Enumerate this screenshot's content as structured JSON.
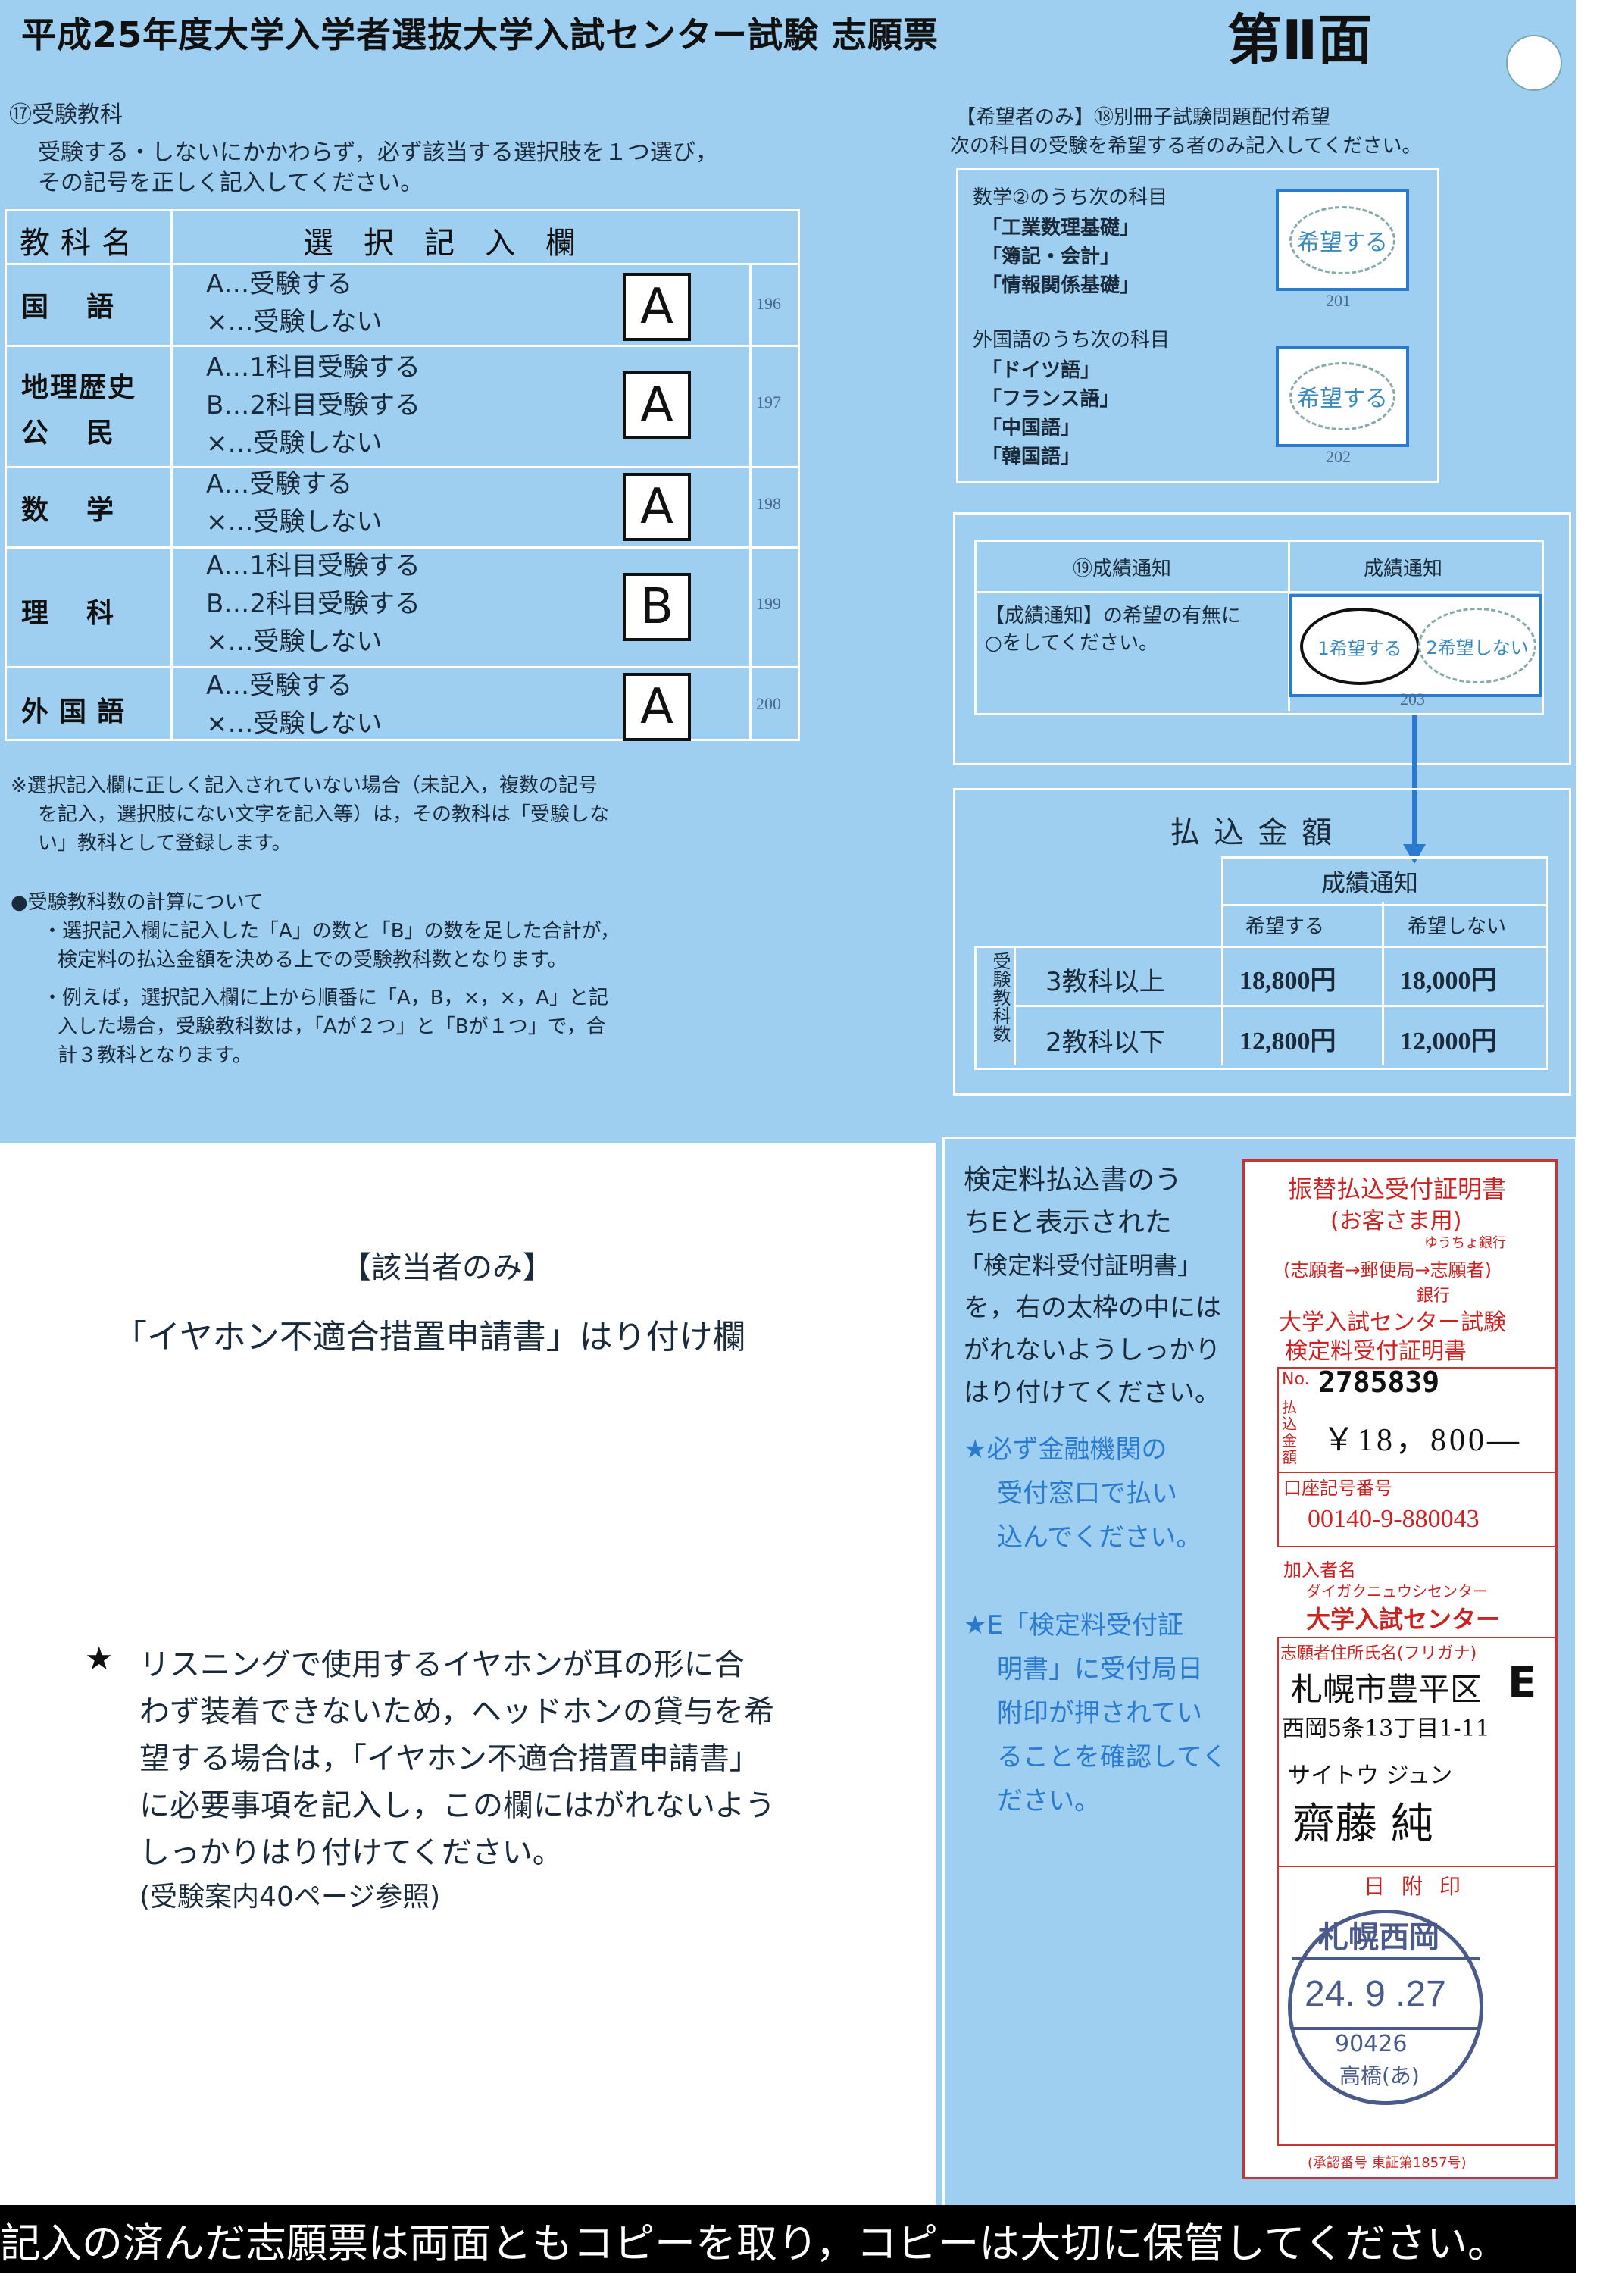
{
  "header": {
    "title": "平成25年度大学入学者選抜大学入試センター試験 志願票",
    "side": "第Ⅱ面"
  },
  "section17": {
    "heading": "⑰受験教科",
    "instr1": "受験する・しないにかかわらず，必ず該当する選択肢を１つ選び，",
    "instr2": "その記号を正しく記入してください。",
    "col_subject": "教科名",
    "col_select": "選択記入欄",
    "rows": [
      {
        "name": "国語",
        "options": [
          "A…受験する",
          "×…受験しない"
        ],
        "answer": "A",
        "code": "196"
      },
      {
        "name1": "地理歴史",
        "name2": "公民",
        "options": [
          "A…1科目受験する",
          "B…2科目受験する",
          "×…受験しない"
        ],
        "answer": "A",
        "code": "197"
      },
      {
        "name": "数学",
        "options": [
          "A…受験する",
          "×…受験しない"
        ],
        "answer": "A",
        "code": "198"
      },
      {
        "name": "理科",
        "options": [
          "A…1科目受験する",
          "B…2科目受験する",
          "×…受験しない"
        ],
        "answer": "B",
        "code": "199"
      },
      {
        "name": "外国語",
        "options": [
          "A…受験する",
          "×…受験しない"
        ],
        "answer": "A",
        "code": "200"
      }
    ],
    "note1": "※選択記入欄に正しく記入されていない場合（未記入，複数の記号",
    "note2": "を記入，選択肢にない文字を記入等）は，その教科は「受験しな",
    "note3": "い」教科として登録します。",
    "calc_heading": "●受験教科数の計算について",
    "calc1": "・選択記入欄に記入した「A」の数と「B」の数を足した合計が，",
    "calc2": "検定料の払込金額を決める上での受験教科数となります。",
    "calc3": "・例えば，選択記入欄に上から順番に「A，B，×，×，A」と記",
    "calc4": "入した場合，受験教科数は，「Aが２つ」と「Bが１つ」で，合",
    "calc5": "計３教科となります。"
  },
  "section18": {
    "heading": "【希望者のみ】⑱別冊子試験問題配付希望",
    "sub": "次の科目の受験を希望する者のみ記入してください。",
    "group1_title": "数学②のうち次の科目",
    "group1": [
      "「工業数理基礎」",
      "「簿記・会計」",
      "「情報関係基礎」"
    ],
    "group1_opt": "希望する",
    "group1_code": "201",
    "group2_title": "外国語のうち次の科目",
    "group2": [
      "「ドイツ語」",
      "「フランス語」",
      "「中国語」",
      "「韓国語」"
    ],
    "group2_opt": "希望する",
    "group2_code": "202"
  },
  "section19": {
    "heading": "⑲成績通知",
    "col": "成績通知",
    "desc1": "【成績通知】の希望の有無に",
    "desc2": "○をしてください。",
    "opt1": "1希望する",
    "opt2": "2希望しない",
    "code": "203"
  },
  "fees": {
    "title": "払込金額",
    "header": "成績通知",
    "col1": "希望する",
    "col2": "希望しない",
    "side": "受験教科数",
    "rows": [
      {
        "label": "3教科以上",
        "v1": "18,800円",
        "v2": "18,000円"
      },
      {
        "label": "2教科以下",
        "v1": "12,800円",
        "v2": "12,000円"
      }
    ]
  },
  "earphone": {
    "heading": "【該当者のみ】",
    "title": "「イヤホン不適合措置申請書」はり付け欄",
    "star": "★",
    "body1": "リスニングで使用するイヤホンが耳の形に合",
    "body2": "わず装着できないため，ヘッドホンの貸与を希",
    "body3": "望する場合は，「イヤホン不適合措置申請書」",
    "body4": "に必要事項を記入し，この欄にはがれないよう",
    "body5": "しっかりはり付けてください。",
    "ref": "(受験案内40ページ参照)"
  },
  "receipt_instr": {
    "l1": "検定料払込書のう",
    "l2": "ちEと表示された",
    "l3": "「検定料受付証明書」",
    "l4": "を，右の太枠の中には",
    "l5": "がれないようしっかり",
    "l6": "はり付けてください。",
    "s1a": "★必ず金融機関の",
    "s1b": "受付窓口で払い",
    "s1c": "込んでください。",
    "s2a": "★E「検定料受付証",
    "s2b": "明書」に受付局日",
    "s2c": "附印が押されてい",
    "s2d": "ることを確認してく",
    "s2e": "ださい。"
  },
  "certificate": {
    "t1": "振替払込受付証明書",
    "t2": "(お客さま用)",
    "t3": "ゆうちょ銀行",
    "t4": "(志願者→郵便局→志願者)",
    "t5": "銀行",
    "t6": "大学入試センター試験",
    "t7": "検定料受付証明書",
    "no_label": "No.",
    "no": "2785839",
    "amount_label": "払込金額",
    "amount": "￥18，800―",
    "acct_label": "口座記号番号",
    "acct": "00140-9-880043",
    "payee_label": "加入者名",
    "payee_kana": "ダイガクニュウシセンター",
    "payee": "大学入試センター",
    "applicant_label": "志願者住所氏名(フリガナ)",
    "mark": "E",
    "addr1": "札幌市豊平区",
    "addr2": "西岡5条13丁目1-11",
    "kana": "サイトウ ジュン",
    "name": "齋藤 純",
    "stamp_label": "日附印",
    "stamp_top": "札幌西岡",
    "stamp_date": "24. 9 .27",
    "stamp_code": "90426",
    "stamp_person": "高橋(あ)",
    "approval": "(承認番号 東証第1857号)"
  },
  "footer": "記入の済んだ志願票は両面ともコピーを取り，コピーは大切に保管してください。"
}
